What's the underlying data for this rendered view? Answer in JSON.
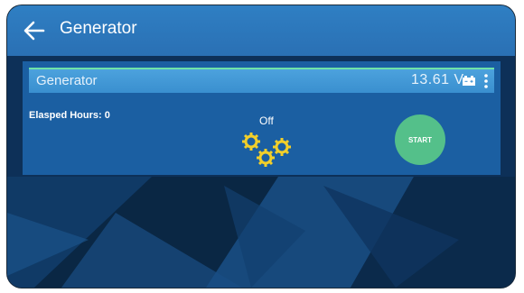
{
  "header": {
    "title": "Generator"
  },
  "generator_card": {
    "title": "Generator",
    "voltage": "13.61 V",
    "elapsed_hours": "Elasped Hours: 0",
    "status": "Off",
    "start_label": "START"
  },
  "colors": {
    "header_blue": "#2f7fc3",
    "card_blue": "#1b5fa2",
    "card_header_blue": "#4ca2dd",
    "start_green": "#54c08a",
    "gear_yellow": "#f2cf2a"
  },
  "icons": {
    "back": "arrow-left-icon",
    "battery": "battery-icon",
    "menu": "more-vertical-icon",
    "gears": "gears-icon"
  }
}
